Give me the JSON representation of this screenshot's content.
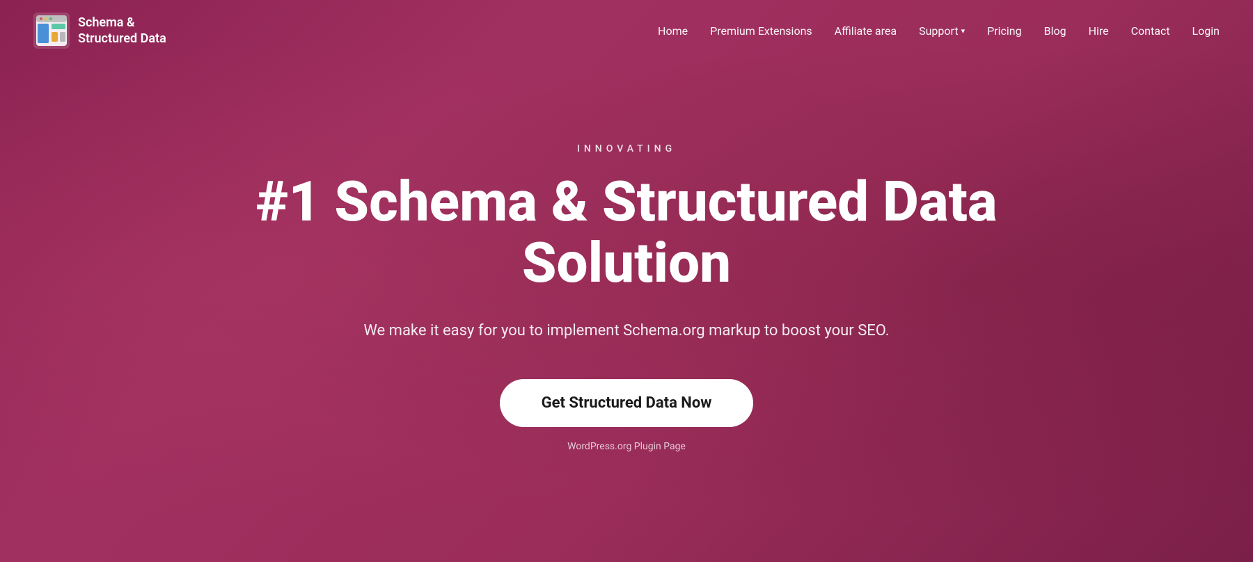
{
  "logo": {
    "text_line1": "Schema &",
    "text_line2": "Structured Data",
    "alt": "Schema & Structured Data Logo"
  },
  "nav": {
    "items": [
      {
        "label": "Home",
        "href": "#"
      },
      {
        "label": "Premium Extensions",
        "href": "#"
      },
      {
        "label": "Affiliate area",
        "href": "#"
      },
      {
        "label": "Support",
        "href": "#",
        "hasDropdown": true
      },
      {
        "label": "Pricing",
        "href": "#"
      },
      {
        "label": "Blog",
        "href": "#"
      },
      {
        "label": "Hire",
        "href": "#"
      },
      {
        "label": "Contact",
        "href": "#"
      },
      {
        "label": "Login",
        "href": "#"
      }
    ]
  },
  "hero": {
    "eyebrow": "INNOVATING",
    "title": "#1 Schema & Structured Data Solution",
    "subtitle": "We make it easy for you to implement Schema.org markup to boost your SEO.",
    "cta_button": "Get Structured Data Now",
    "wp_link": "WordPress.org Plugin Page"
  },
  "colors": {
    "bg_start": "#8b2252",
    "bg_end": "#7a1f48",
    "text_primary": "#ffffff",
    "button_bg": "#ffffff",
    "button_text": "#1a1a1a"
  }
}
